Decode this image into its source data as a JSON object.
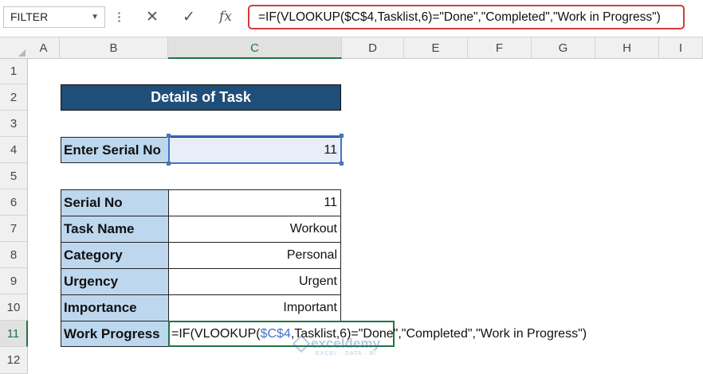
{
  "formula_bar": {
    "name_box": "FILTER",
    "cancel_icon": "✕",
    "enter_icon": "✓",
    "fx_label": "fx",
    "formula": "=IF(VLOOKUP($C$4,Tasklist,6)=\"Done\",\"Completed\",\"Work in Progress\")"
  },
  "columns": [
    "A",
    "B",
    "C",
    "D",
    "E",
    "F",
    "G",
    "H",
    "I"
  ],
  "rows": [
    "1",
    "2",
    "3",
    "4",
    "5",
    "6",
    "7",
    "8",
    "9",
    "10",
    "11",
    "12"
  ],
  "sheet": {
    "title": "Details of Task",
    "input_label": "Enter Serial No",
    "input_value": "11",
    "details": [
      {
        "label": "Serial No",
        "value": "11"
      },
      {
        "label": "Task Name",
        "value": "Workout"
      },
      {
        "label": "Category",
        "value": "Personal"
      },
      {
        "label": "Urgency",
        "value": "Urgent"
      },
      {
        "label": "Importance",
        "value": "Important"
      }
    ],
    "work_progress_label": "Work Progress",
    "editing_formula": {
      "prefix": "=IF(VLOOKUP(",
      "ref": "$C$4",
      "suffix": ",Tasklist,6)=\"Done\",\"Completed\",\"Work in Progress\")"
    }
  },
  "watermark": {
    "name": "exceldemy",
    "tagline": "EXCEL · DATA · BI"
  },
  "colors": {
    "title_bg": "#1f4e79",
    "label_bg": "#bdd7ee",
    "selection": "#217346",
    "highlight_box": "#d33b3b",
    "ref_color": "#4472c4"
  }
}
